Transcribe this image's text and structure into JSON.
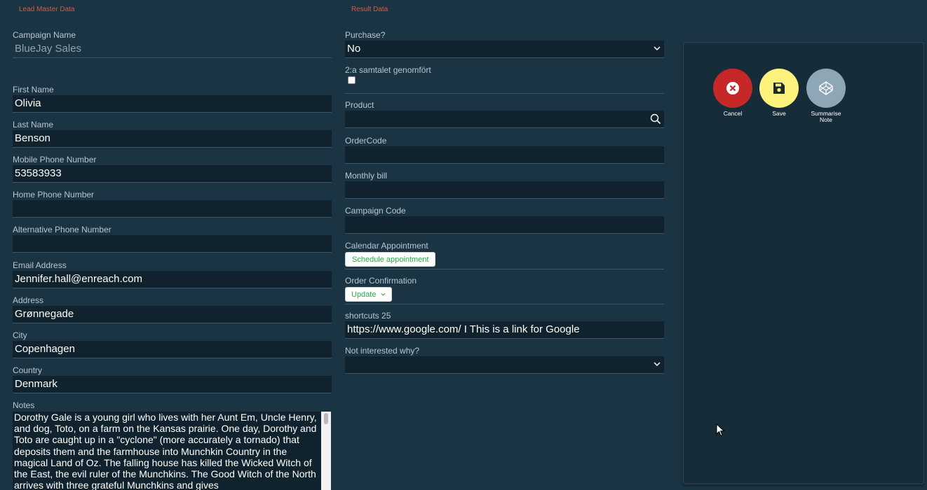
{
  "headers": {
    "lead_master": "Lead Master Data",
    "result": "Result Data"
  },
  "lead": {
    "campaign_name": {
      "label": "Campaign Name",
      "value": "BlueJay Sales"
    },
    "first_name": {
      "label": "First Name",
      "value": "Olivia"
    },
    "last_name": {
      "label": "Last Name",
      "value": "Benson"
    },
    "mobile_phone": {
      "label": "Mobile Phone Number",
      "value": "53583933"
    },
    "home_phone": {
      "label": "Home Phone Number",
      "value": ""
    },
    "alt_phone": {
      "label": "Alternative Phone Number",
      "value": ""
    },
    "email": {
      "label": "Email Address",
      "value": "Jennifer.hall@enreach.com"
    },
    "address": {
      "label": "Address",
      "value": "Grønnegade"
    },
    "city": {
      "label": "City",
      "value": "Copenhagen"
    },
    "country": {
      "label": "Country",
      "value": "Denmark"
    },
    "notes": {
      "label": "Notes",
      "value": "Dorothy Gale is a young girl who lives with her Aunt Em, Uncle Henry, and dog, Toto, on a farm on the Kansas prairie. One day, Dorothy and Toto are caught up in a \"cyclone\" (more accurately a tornado) that deposits them and the farmhouse into Munchkin Country in the magical Land of Oz. The falling house has killed the Wicked Witch of the East, the evil ruler of the Munchkins. The Good Witch of the North arrives with three grateful Munchkins and gives"
    }
  },
  "result": {
    "purchase": {
      "label": "Purchase?",
      "value": "No"
    },
    "second_call": {
      "label": "2:a samtalet genomfört",
      "checked": false
    },
    "product": {
      "label": "Product",
      "value": ""
    },
    "order_code": {
      "label": "OrderCode",
      "value": ""
    },
    "monthly_bill": {
      "label": "Monthly bill",
      "value": ""
    },
    "campaign_code": {
      "label": "Campaign Code",
      "value": ""
    },
    "calendar": {
      "label": "Calendar Appointment",
      "button": "Schedule appointment"
    },
    "order_confirmation": {
      "label": "Order Confirmation",
      "button": "Update"
    },
    "shortcuts": {
      "label": "shortcuts 25",
      "value": "https://www.google.com/ I This is a link for Google"
    },
    "not_interested": {
      "label": "Not interested why?",
      "value": ""
    }
  },
  "actions": {
    "cancel": {
      "label": "Cancel",
      "color": "#c62828",
      "icon": "close-circle-icon"
    },
    "save": {
      "label": "Save",
      "color": "#fdf27c",
      "icon": "floppy-disk-icon"
    },
    "summarise": {
      "label_line1": "Summarise",
      "label_line2": "Note",
      "color": "#8ea7b6",
      "icon": "codepen-icon"
    }
  },
  "colors": {
    "background": "#1b3443",
    "field": "#10222d",
    "section_title": "#e0583a",
    "button_text": "#2ea84a"
  }
}
